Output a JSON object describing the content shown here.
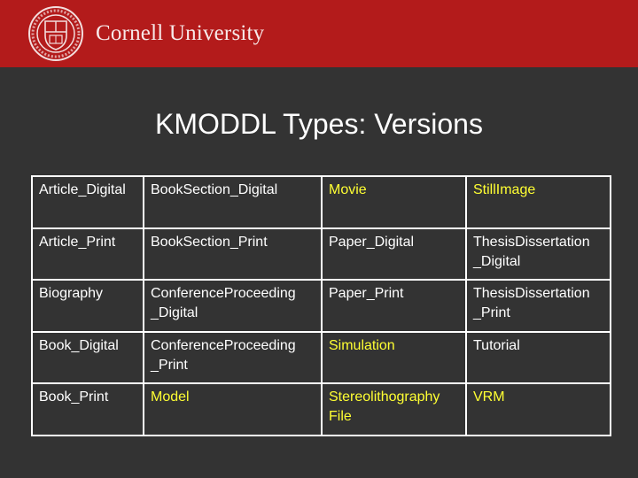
{
  "header": {
    "logo_icon": "cornell-seal-icon",
    "wordmark": "Cornell University",
    "brand_color": "#b31b1b"
  },
  "slide": {
    "title": "KMODDL Types: Versions",
    "highlight_color": "#ffff33",
    "table": {
      "rows": [
        [
          {
            "text": "Article_Digital",
            "hl": false
          },
          {
            "text": "BookSection_Digital",
            "hl": false
          },
          {
            "text": "Movie",
            "hl": true
          },
          {
            "text": "StillImage",
            "hl": true
          }
        ],
        [
          {
            "text": "Article_Print",
            "hl": false
          },
          {
            "text": "BookSection_Print",
            "hl": false
          },
          {
            "text": "Paper_Digital",
            "hl": false
          },
          {
            "text": "ThesisDissertation _Digital",
            "hl": false
          }
        ],
        [
          {
            "text": "Biography",
            "hl": false
          },
          {
            "text": "ConferenceProceeding _Digital",
            "hl": false
          },
          {
            "text": "Paper_Print",
            "hl": false
          },
          {
            "text": "ThesisDissertation _Print",
            "hl": false
          }
        ],
        [
          {
            "text": "Book_Digital",
            "hl": false
          },
          {
            "text": "ConferenceProceeding _Print",
            "hl": false
          },
          {
            "text": "Simulation",
            "hl": true
          },
          {
            "text": "Tutorial",
            "hl": false
          }
        ],
        [
          {
            "text": "Book_Print",
            "hl": false
          },
          {
            "text": "Model",
            "hl": true
          },
          {
            "text": "Stereolithography File",
            "hl": true
          },
          {
            "text": "VRM",
            "hl": true
          }
        ]
      ]
    }
  }
}
